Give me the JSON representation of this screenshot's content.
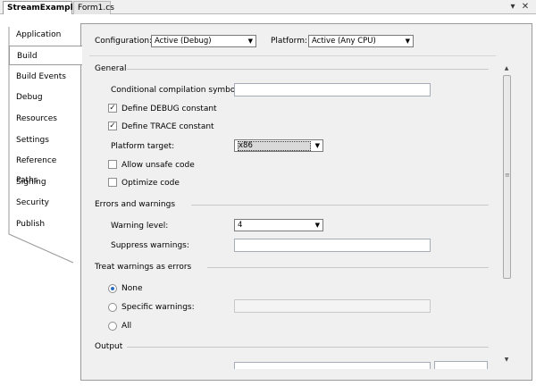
{
  "doc_tabs": {
    "active": "StreamExample",
    "inactive": "Form1.cs",
    "dropdown_icon": "chevron-down-icon",
    "close_icon": "close-icon"
  },
  "left_tabs": [
    {
      "label": "Application"
    },
    {
      "label": "Build"
    },
    {
      "label": "Build Events"
    },
    {
      "label": "Debug"
    },
    {
      "label": "Resources"
    },
    {
      "label": "Settings"
    },
    {
      "label": "Reference Paths"
    },
    {
      "label": "Signing"
    },
    {
      "label": "Security"
    },
    {
      "label": "Publish"
    }
  ],
  "active_left_tab": "Build",
  "config_bar": {
    "configuration_label": "Configuration:",
    "configuration_value": "Active (Debug)",
    "platform_label": "Platform:",
    "platform_value": "Active (Any CPU)"
  },
  "general": {
    "header": "General",
    "symbols_label": "Conditional compilation symbols:",
    "symbols_value": "",
    "define_debug_label": "Define DEBUG constant",
    "define_debug_checked": true,
    "define_trace_label": "Define TRACE constant",
    "define_trace_checked": true,
    "platform_target_label": "Platform target:",
    "platform_target_value": "x86",
    "allow_unsafe_label": "Allow unsafe code",
    "allow_unsafe_checked": false,
    "optimize_label": "Optimize code",
    "optimize_checked": false
  },
  "errors": {
    "header": "Errors and warnings",
    "warning_level_label": "Warning level:",
    "warning_level_value": "4",
    "suppress_label": "Suppress warnings:",
    "suppress_value": ""
  },
  "treat_warnings": {
    "header": "Treat warnings as errors",
    "options": [
      {
        "label": "None",
        "selected": true
      },
      {
        "label": "Specific warnings:",
        "selected": false
      },
      {
        "label": "All",
        "selected": false
      }
    ]
  },
  "output": {
    "header": "Output"
  },
  "colors": {
    "content_bg": "#f0f0f0",
    "border": "#9a9a9a",
    "radio_accent": "#2a6cc0"
  }
}
